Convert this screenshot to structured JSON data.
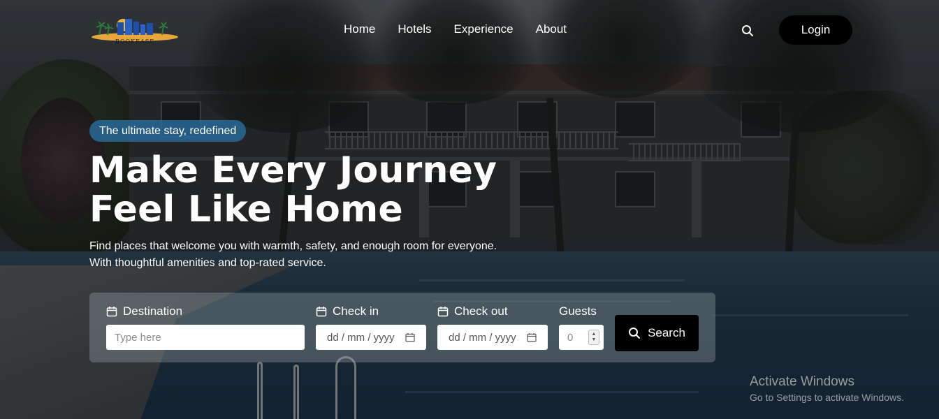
{
  "brand": {
    "logo_text": "BOOKEASE"
  },
  "nav": {
    "items": [
      {
        "label": "Home"
      },
      {
        "label": "Hotels"
      },
      {
        "label": "Experience"
      },
      {
        "label": "About"
      }
    ],
    "search_icon": "search-icon",
    "login_label": "Login"
  },
  "hero": {
    "tagline": "The ultimate stay, redefined",
    "title_line1": "Make Every Journey",
    "title_line2": "Feel Like Home",
    "subtitle_line1": "Find places that welcome you with warmth, safety, and enough room for everyone.",
    "subtitle_line2": "With thoughtful amenities and top-rated service."
  },
  "search_form": {
    "destination": {
      "label": "Destination",
      "placeholder": "Type here",
      "icon": "calendar-icon"
    },
    "check_in": {
      "label": "Check in",
      "placeholder": "dd / mm / yyyy",
      "icon": "calendar-icon"
    },
    "check_out": {
      "label": "Check out",
      "placeholder": "dd / mm / yyyy",
      "icon": "calendar-icon"
    },
    "guests": {
      "label": "Guests",
      "value": "0"
    },
    "submit_label": "Search"
  },
  "watermark": {
    "title": "Activate Windows",
    "subtitle": "Go to Settings to activate Windows."
  },
  "colors": {
    "tagline_bg": "#2868a0",
    "button_bg": "#000000",
    "panel_bg": "#96a0a6"
  }
}
